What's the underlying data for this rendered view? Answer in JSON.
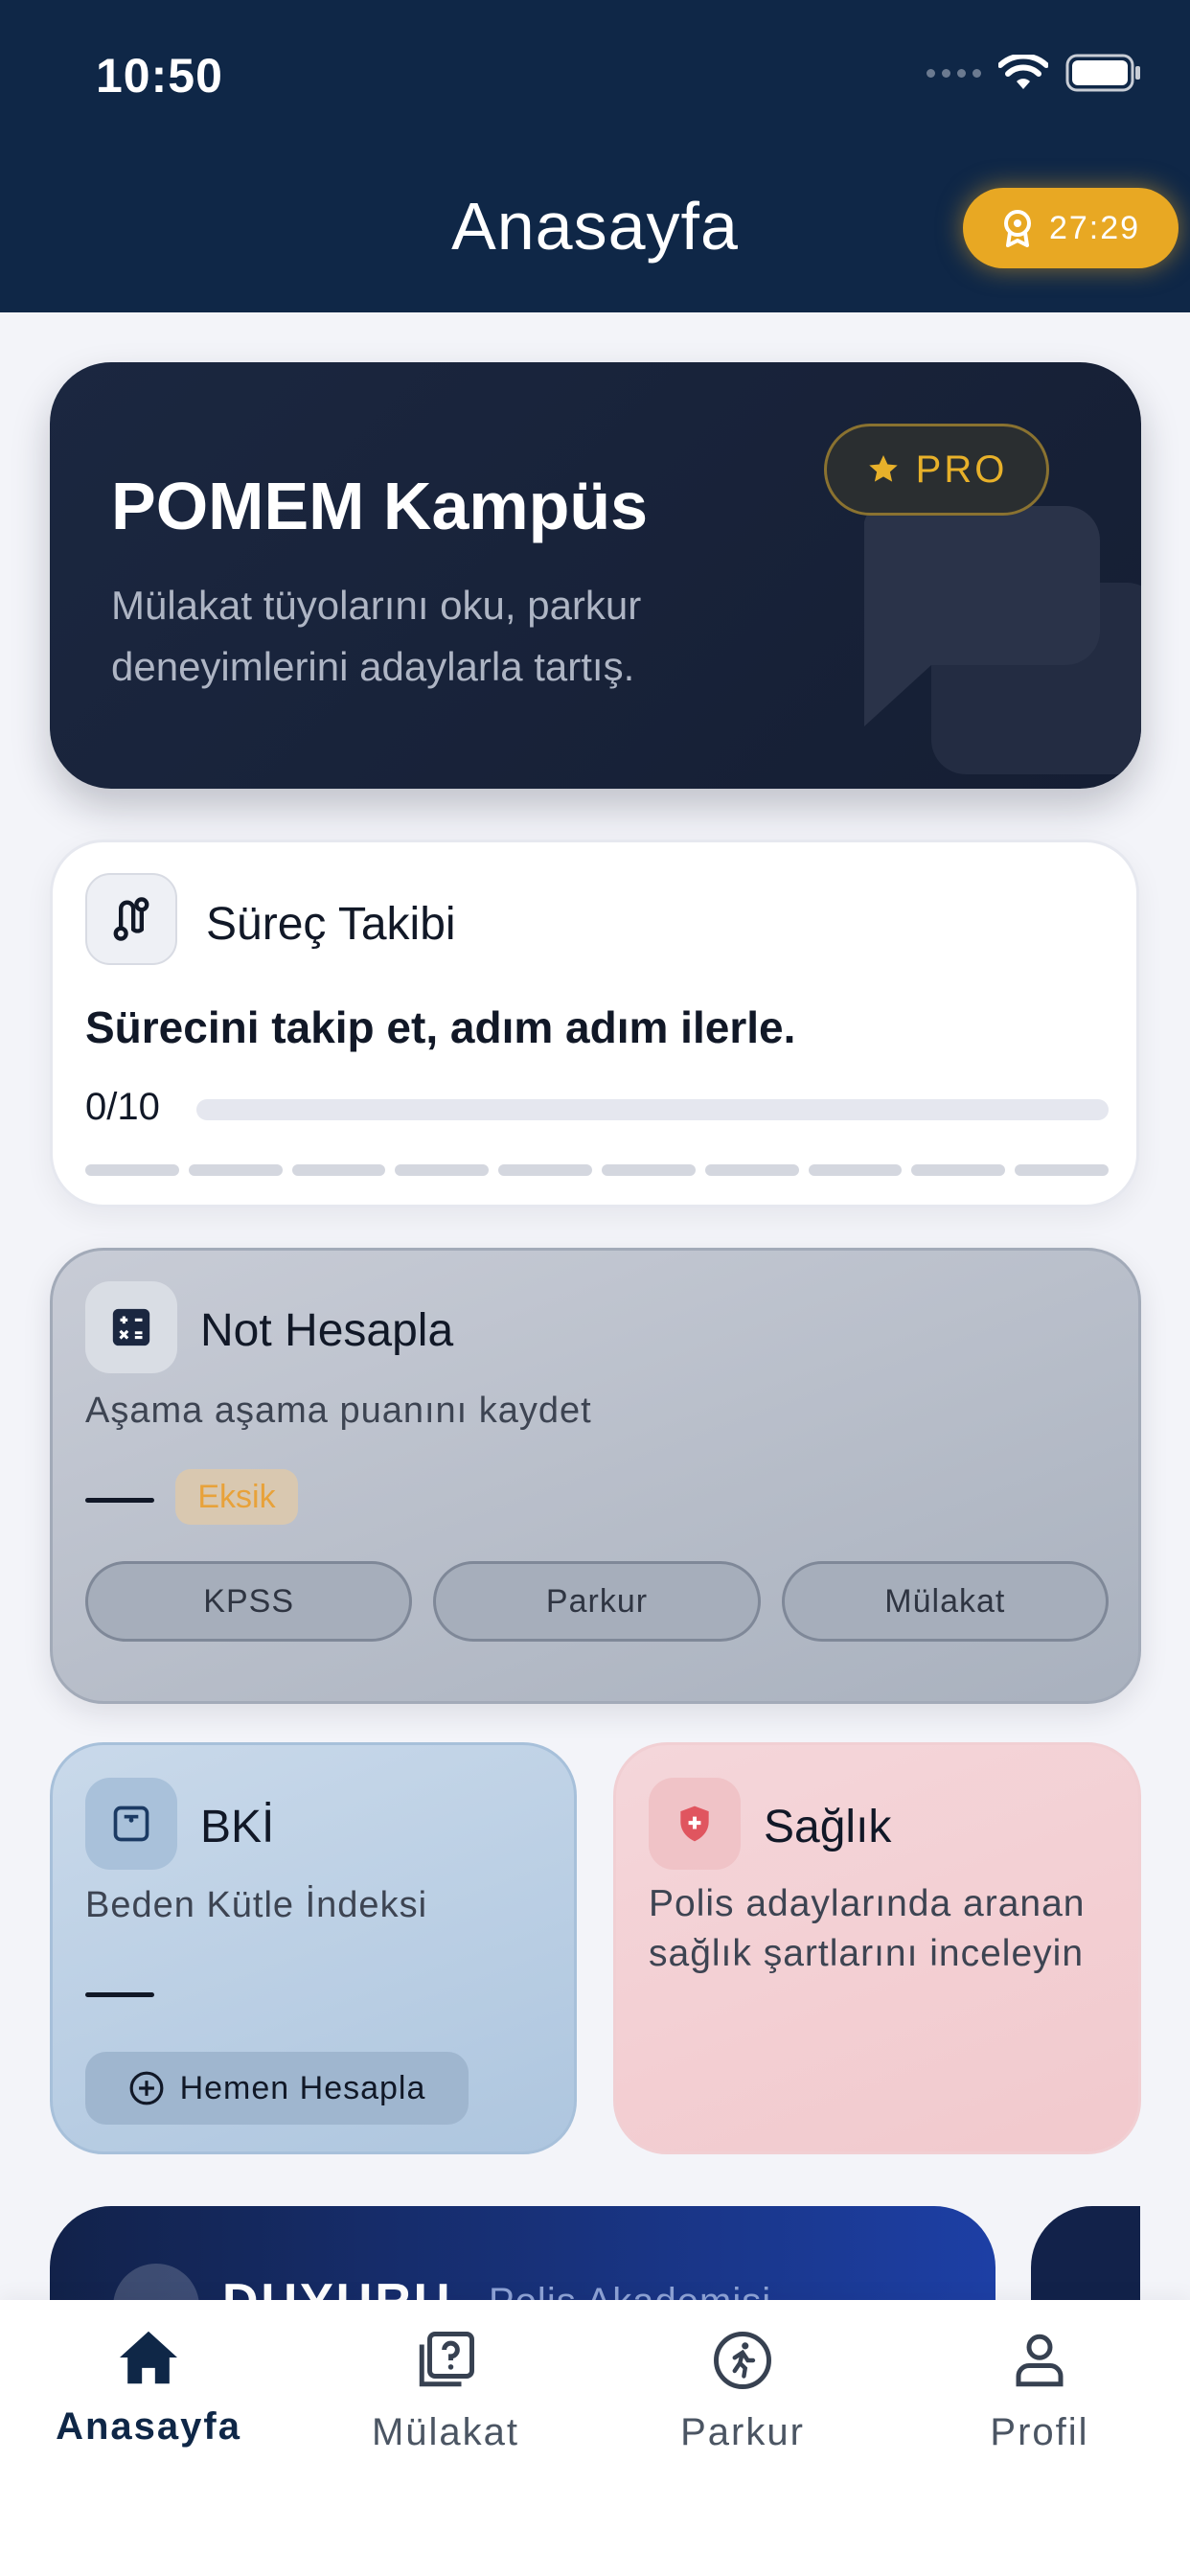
{
  "status_bar": {
    "time": "10:50"
  },
  "header": {
    "title": "Anasayfa",
    "timer": "27:29"
  },
  "hero": {
    "title": "POMEM Kampüs",
    "description": "Mülakat tüyolarını oku, parkur deneyimlerini adaylarla tartış.",
    "badge": "PRO"
  },
  "process": {
    "title": "Süreç Takibi",
    "subtitle": "Sürecini takip et, adım adım ilerle.",
    "progress_text": "0/10",
    "completed_steps": 0,
    "total_steps": 10
  },
  "grade": {
    "title": "Not Hesapla",
    "subtitle": "Aşama aşama puanını kaydet",
    "status": "Eksik",
    "pills": [
      "KPSS",
      "Parkur",
      "Mülakat"
    ]
  },
  "bmi": {
    "title": "BKİ",
    "subtitle": "Beden Kütle İndeksi",
    "button": "Hemen Hesapla"
  },
  "health": {
    "title": "Sağlık",
    "subtitle": "Polis adaylarında aranan sağlık şartlarını inceleyin"
  },
  "announcement": {
    "label": "DUYURU",
    "source": "Polis Akademisi"
  },
  "tabbar": {
    "tabs": [
      {
        "label": "Anasayfa",
        "icon": "home-icon",
        "active": true
      },
      {
        "label": "Mülakat",
        "icon": "question-cards-icon",
        "active": false
      },
      {
        "label": "Parkur",
        "icon": "running-icon",
        "active": false
      },
      {
        "label": "Profil",
        "icon": "person-icon",
        "active": false
      }
    ]
  },
  "colors": {
    "header_bg": "#0f2747",
    "timer_badge": "#e8a823",
    "pro_gold": "#e8b12a",
    "missing_orange": "#e8a23a"
  }
}
